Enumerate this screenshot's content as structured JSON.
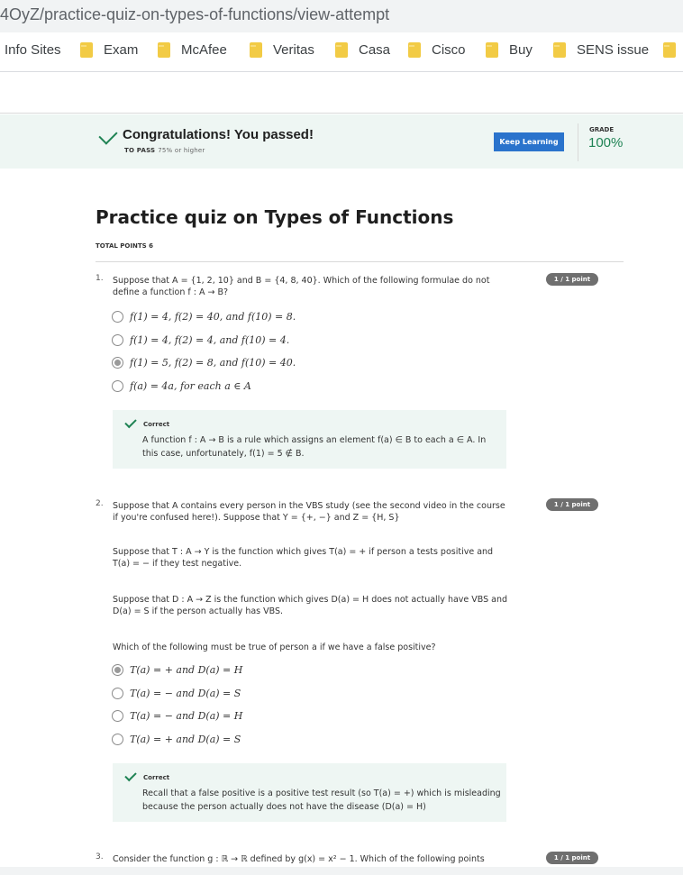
{
  "browser": {
    "url": "4OyZ/practice-quiz-on-types-of-functions/view-attempt",
    "bookmarks": [
      "Info Sites",
      "Exam",
      "McAfee",
      "Veritas",
      "Casa",
      "Cisco",
      "Buy",
      "SENS issue"
    ]
  },
  "banner": {
    "title": "Congratulations! You passed!",
    "to_pass_label": "TO PASS",
    "to_pass_value": "75% or higher",
    "button_label": "Keep Learning",
    "grade_label": "GRADE",
    "grade_value": "100%",
    "accent_color": "#1f8354",
    "button_color": "#2a73cc"
  },
  "quiz": {
    "title": "Practice quiz on Types of Functions",
    "total_points": "TOTAL POINTS 6"
  },
  "questions": [
    {
      "number": "1.",
      "points": "1 / 1 point",
      "text": "Suppose that A = {1, 2, 10} and B = {4, 8, 40}. Which of the following formulae do not define a function f : A → B?",
      "options": [
        "f(1) = 4, f(2) = 40, and f(10) = 8.",
        "f(1) = 4, f(2) = 4, and f(10) = 4.",
        "f(1) = 5, f(2) = 8, and f(10) = 40.",
        "f(a) = 4a, for each a ∈ A"
      ],
      "selected": 2,
      "feedback_label": "Correct",
      "feedback": "A function f : A → B is a rule which assigns an element f(a) ∈ B to each a ∈ A. In this case, unfortunately, f(1) = 5 ∉ B."
    },
    {
      "number": "2.",
      "points": "1 / 1 point",
      "paragraphs": [
        "Suppose that A contains every person in the VBS study (see the second video in the course if you're confused here!). Suppose that Y = {+, −} and Z = {H, S}",
        "Suppose that T : A → Y is the function which gives T(a) = + if person a tests positive and T(a) = − if they test negative.",
        "Suppose that D : A → Z is the function which gives D(a) = H does not actually have VBS and D(a) = S if the person actually has VBS.",
        "Which of the following must be true of person a if we have a false positive?"
      ],
      "options": [
        "T(a) = + and D(a) = H",
        "T(a) = − and D(a) = S",
        "T(a) = − and D(a) = H",
        "T(a) = + and D(a) = S"
      ],
      "selected": 0,
      "feedback_label": "Correct",
      "feedback": "Recall that a false positive is a positive test result (so T(a) = +) which is misleading because the person actually does not have the disease (D(a) = H)"
    },
    {
      "number": "3.",
      "points": "1 / 1 point",
      "text": "Consider the function g : ℝ → ℝ defined by g(x) = x² − 1. Which of the following points"
    }
  ]
}
